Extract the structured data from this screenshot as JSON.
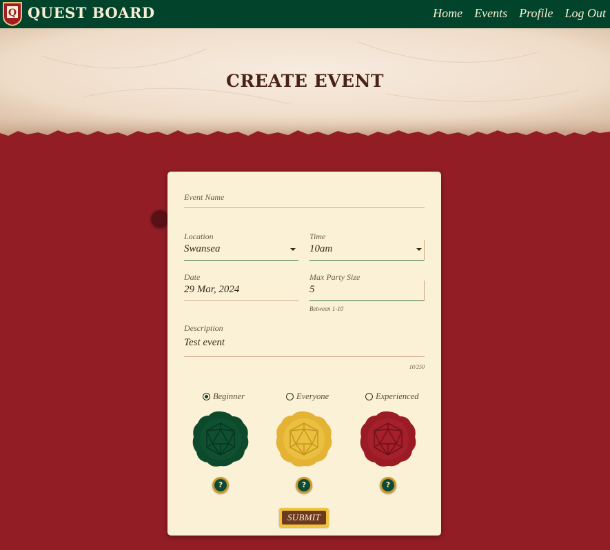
{
  "nav": {
    "brand": "QUEST BOARD",
    "logo_letter": "Q",
    "links": [
      "Home",
      "Events",
      "Profile",
      "Log Out"
    ]
  },
  "page": {
    "title": "CREATE EVENT"
  },
  "form": {
    "event_name": {
      "label": "Event Name",
      "value": ""
    },
    "location": {
      "label": "Location",
      "value": "Swansea"
    },
    "time": {
      "label": "Time",
      "value": "10am"
    },
    "date": {
      "label": "Date",
      "value": "29 Mar, 2024"
    },
    "max_party_size": {
      "label": "Max Party Size",
      "value": "5",
      "helper": "Between 1-10"
    },
    "description": {
      "label": "Description",
      "value": "Test event",
      "counter": "10/250"
    },
    "levels": [
      {
        "label": "Beginner",
        "checked": true,
        "seal_color": "#0d4a2c"
      },
      {
        "label": "Everyone",
        "checked": false,
        "seal_color": "#e8b83a"
      },
      {
        "label": "Experienced",
        "checked": false,
        "seal_color": "#9b1b25"
      }
    ],
    "help_icon": "?",
    "submit_label": "SUBMIT"
  },
  "colors": {
    "navbar": "#02432c",
    "background": "#921d25",
    "card": "#fbf1d6",
    "title": "#4a2317"
  }
}
